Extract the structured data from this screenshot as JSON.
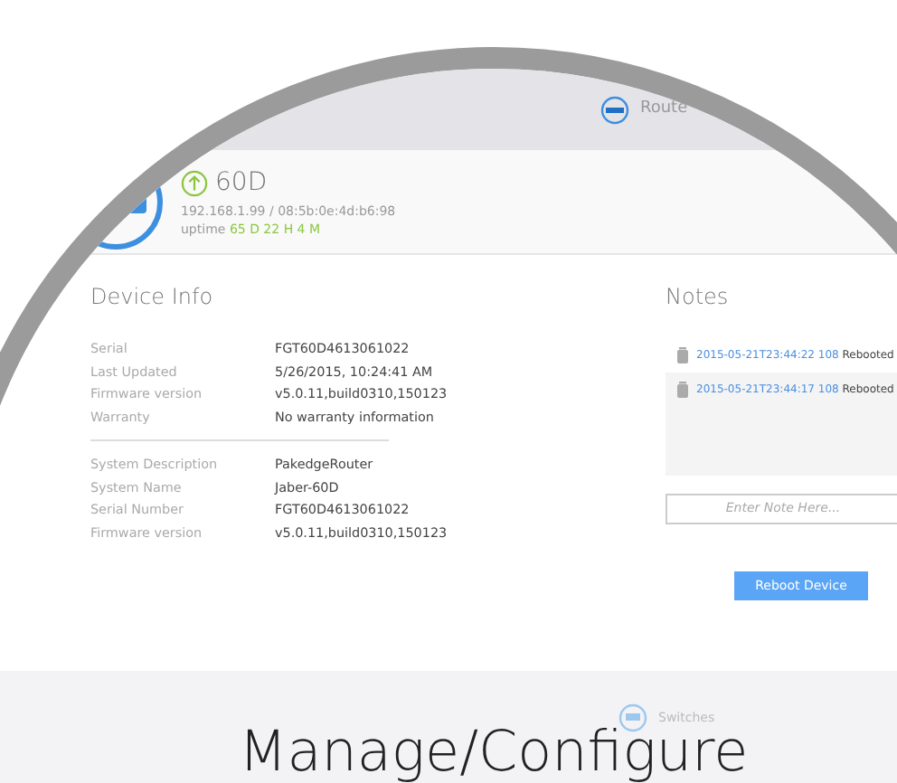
{
  "top_bar": {
    "label": "Route"
  },
  "device": {
    "name": "60D",
    "address": "192.168.1.99 / 08:5b:0e:4d:b6:98",
    "uptime_label": "uptime",
    "uptime": "65 D 22 H 4 M"
  },
  "device_info": {
    "title": "Device Info",
    "groups": [
      [
        {
          "label": "Serial",
          "value": "FGT60D4613061022"
        },
        {
          "label": "Last Updated",
          "value": "5/26/2015, 10:24:41 AM"
        },
        {
          "label": "Firmware version",
          "value": "v5.0.11,build0310,150123"
        },
        {
          "label": "Warranty",
          "value": "No warranty information"
        }
      ],
      [
        {
          "label": "System Description",
          "value": "PakedgeRouter"
        },
        {
          "label": "System Name",
          "value": "Jaber-60D"
        },
        {
          "label": "Serial Number",
          "value": "FGT60D4613061022"
        },
        {
          "label": "Firmware version",
          "value": "v5.0.11,build0310,150123"
        }
      ]
    ]
  },
  "notes": {
    "title": "Notes",
    "items": [
      {
        "stamp": "2015-05-21T23:44:22 108",
        "text": "Rebooted"
      },
      {
        "stamp": "2015-05-21T23:44:17 108",
        "text": "Rebooted"
      }
    ],
    "input": {
      "placeholder": "Enter Note Here..."
    },
    "button": "Reboot Device"
  },
  "bottom_bar": {
    "label": "Switches"
  },
  "caption": "Manage/Configure"
}
